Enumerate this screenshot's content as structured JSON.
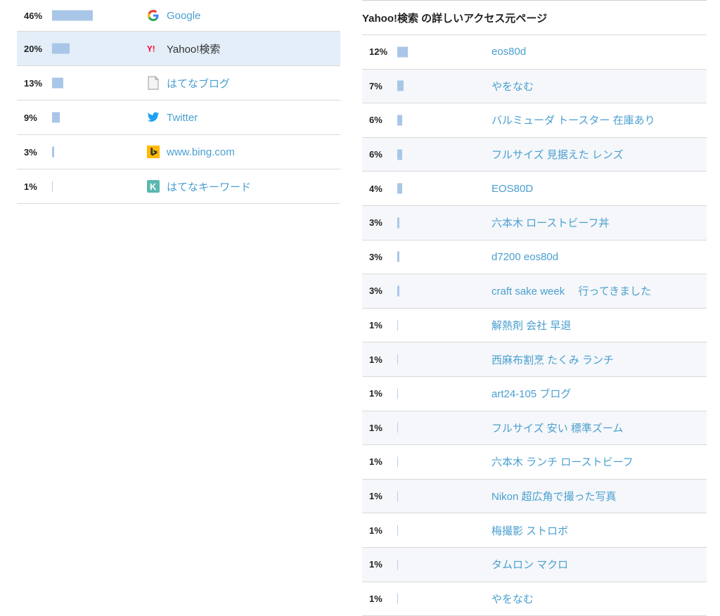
{
  "referrers": [
    {
      "pct": "46%",
      "value": 46,
      "label": "Google",
      "icon": "google-icon"
    },
    {
      "pct": "20%",
      "value": 20,
      "label": "Yahoo!検索",
      "icon": "yahoo-icon"
    },
    {
      "pct": "13%",
      "value": 13,
      "label": "はてなブログ",
      "icon": "document-icon"
    },
    {
      "pct": "9%",
      "value": 9,
      "label": "Twitter",
      "icon": "twitter-bird-icon"
    },
    {
      "pct": "3%",
      "value": 3,
      "label": "www.bing.com",
      "icon": "bing-icon"
    },
    {
      "pct": "1%",
      "value": 1,
      "label": "はてなキーワード",
      "icon": "hatena-keyword-icon"
    }
  ],
  "detail": {
    "title": "Yahoo!検索 の詳しいアクセス元ページ",
    "rows": [
      {
        "pct": "12%",
        "value": 12,
        "keyword": "eos80d"
      },
      {
        "pct": "7%",
        "value": 7,
        "keyword": "やをなむ"
      },
      {
        "pct": "6%",
        "value": 6,
        "keyword": "バルミューダ トースター 在庫あり"
      },
      {
        "pct": "6%",
        "value": 6,
        "keyword": "フルサイズ 見据えた レンズ"
      },
      {
        "pct": "4%",
        "value": 4,
        "keyword": "EOS80D"
      },
      {
        "pct": "3%",
        "value": 3,
        "keyword": "六本木 ローストビーフ丼"
      },
      {
        "pct": "3%",
        "value": 3,
        "keyword": "d7200 eos80d"
      },
      {
        "pct": "3%",
        "value": 3,
        "keyword": "craft sake week　 行ってきました"
      },
      {
        "pct": "1%",
        "value": 1,
        "keyword": "解熱剤 会社 早退"
      },
      {
        "pct": "1%",
        "value": 1,
        "keyword": "西麻布割烹 たくみ ランチ"
      },
      {
        "pct": "1%",
        "value": 1,
        "keyword": "art24-105 ブログ"
      },
      {
        "pct": "1%",
        "value": 1,
        "keyword": "フルサイズ 安い 標準ズーム"
      },
      {
        "pct": "1%",
        "value": 1,
        "keyword": "六本木 ランチ ローストビーフ"
      },
      {
        "pct": "1%",
        "value": 1,
        "keyword": "Nikon 超広角で撮った写真"
      },
      {
        "pct": "1%",
        "value": 1,
        "keyword": "梅撮影 ストロボ"
      },
      {
        "pct": "1%",
        "value": 1,
        "keyword": "タムロン マクロ"
      },
      {
        "pct": "1%",
        "value": 1,
        "keyword": "やをなむ"
      }
    ]
  },
  "colors": {
    "bar": "#a9c6e8",
    "link": "#4a9fd0",
    "selected_row": "#e3eef8"
  }
}
